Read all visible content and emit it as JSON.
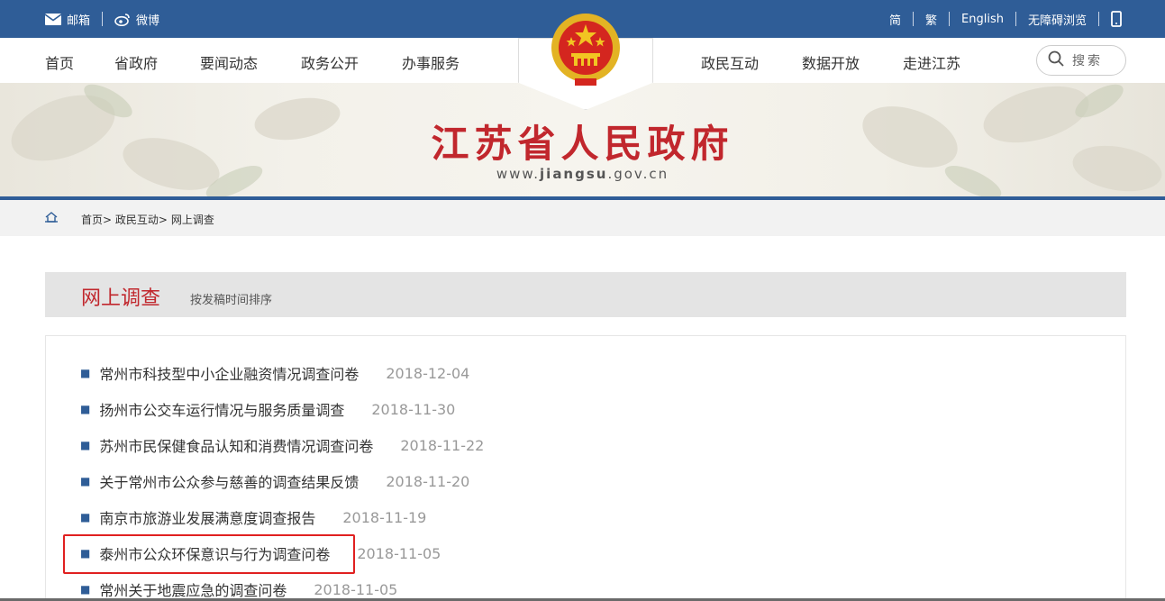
{
  "topbar": {
    "mail": "邮箱",
    "weibo": "微博",
    "simplified": "简",
    "traditional": "繁",
    "english": "English",
    "accessible": "无障碍浏览"
  },
  "nav": {
    "items_left": [
      "首页",
      "省政府",
      "要闻动态",
      "政务公开",
      "办事服务"
    ],
    "items_right": [
      "政民互动",
      "数据开放",
      "走进江苏"
    ],
    "search_label": "搜索"
  },
  "banner": {
    "title": "江苏省人民政府",
    "url_prefix": "www.",
    "url_bold": "jiangsu",
    "url_suffix": ".gov.cn"
  },
  "breadcrumb": {
    "items": [
      "首页",
      "政民互动",
      "网上调查"
    ],
    "separator": ">"
  },
  "section": {
    "title": "网上调查",
    "sort_label": "按发稿时间排序"
  },
  "list": [
    {
      "title": "常州市科技型中小企业融资情况调查问卷",
      "date": "2018-12-04"
    },
    {
      "title": "扬州市公交车运行情况与服务质量调查",
      "date": "2018-11-30"
    },
    {
      "title": "苏州市民保健食品认知和消费情况调查问卷",
      "date": "2018-11-22"
    },
    {
      "title": "关于常州市公众参与慈善的调查结果反馈",
      "date": "2018-11-20"
    },
    {
      "title": "南京市旅游业发展满意度调查报告",
      "date": "2018-11-19"
    },
    {
      "title": "泰州市公众环保意识与行为调查问卷",
      "date": "2018-11-05"
    },
    {
      "title": "常州关于地震应急的调查问卷",
      "date": "2018-11-05"
    }
  ],
  "colors": {
    "primary_blue": "#2f5d97",
    "brand_red": "#c1272d",
    "highlight_red": "#e02020"
  },
  "icons": [
    "mail-icon",
    "weibo-icon",
    "mobile-icon",
    "search-icon",
    "home-icon",
    "national-emblem"
  ]
}
